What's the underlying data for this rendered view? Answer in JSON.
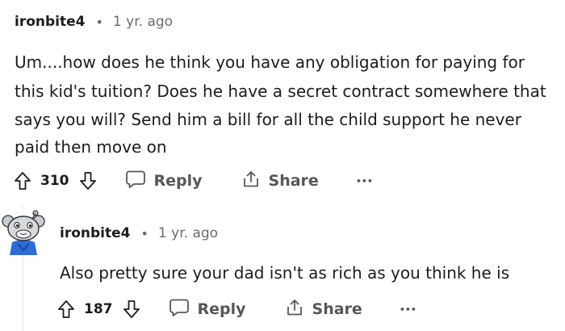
{
  "comments": [
    {
      "username": "ironbite4",
      "separator": "•",
      "time": "1 yr. ago",
      "lines": [
        "Um....how does he think you have any obligation for paying for",
        "this kid's tuition? Does he have a secret contract somewhere that",
        "says you will? Send him a bill for all the child support he never",
        "paid then move on"
      ],
      "score": "310",
      "reply_label": "Reply",
      "share_label": "Share",
      "more_label": "•••"
    },
    {
      "username": "ironbite4",
      "separator": "•",
      "time": "1 yr. ago",
      "lines": [
        "Also pretty sure your dad isn't as rich as you think he is"
      ],
      "score": "187",
      "reply_label": "Reply",
      "share_label": "Share",
      "more_label": "•••"
    }
  ],
  "colors": {
    "text": "#1c1c1c",
    "muted": "#6a6d70",
    "action": "#555759",
    "thread_line": "#e4e6e8",
    "avatar_blue": "#2d6bd6"
  },
  "icons": [
    "upvote-icon",
    "downvote-icon",
    "comment-bubble-icon",
    "share-icon",
    "snoo-avatar"
  ]
}
